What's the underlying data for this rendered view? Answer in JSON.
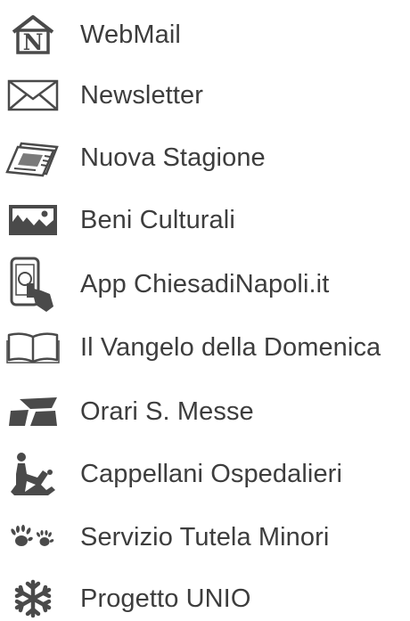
{
  "colors": {
    "text": "#3d3d3d",
    "icon": "#4a4a4a",
    "background": "#ffffff"
  },
  "menu": {
    "items": [
      {
        "label": "WebMail",
        "icon": "house-n-icon"
      },
      {
        "label": "Newsletter",
        "icon": "envelope-icon"
      },
      {
        "label": "Nuova Stagione",
        "icon": "newspaper-icon"
      },
      {
        "label": "Beni Culturali",
        "icon": "landscape-picture-icon"
      },
      {
        "label": "App ChiesadiNapoli.it",
        "icon": "smartphone-touch-icon"
      },
      {
        "label": "Il Vangelo della Domenica",
        "icon": "open-book-icon"
      },
      {
        "label": "Orari S. Messe",
        "icon": "clock-cross-icon"
      },
      {
        "label": "Cappellani Ospedalieri",
        "icon": "kneeling-figure-icon"
      },
      {
        "label": "Servizio Tutela Minori",
        "icon": "hand-prints-icon"
      },
      {
        "label": "Progetto UNIO",
        "icon": "snowflake-icon"
      }
    ]
  }
}
